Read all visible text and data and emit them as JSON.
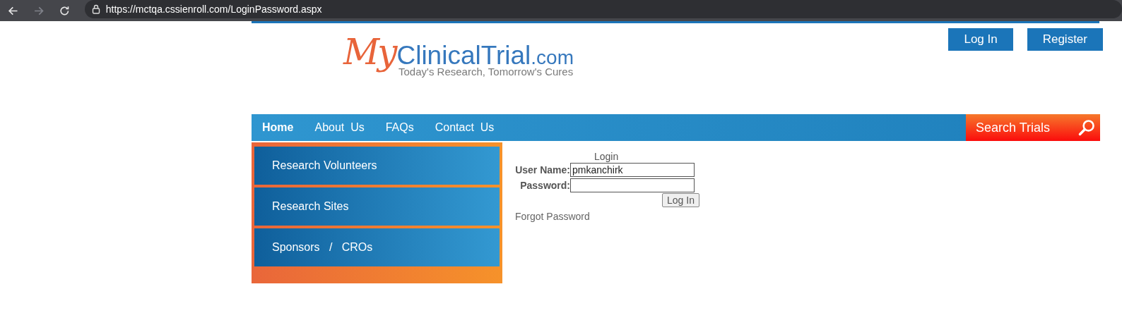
{
  "browser": {
    "url": "https://mctqa.cssienroll.com/LoginPassword.aspx",
    "back_disabled": false,
    "forward_disabled": true
  },
  "logo": {
    "script": "My",
    "name": "ClinicalTrial",
    "domain": ".com",
    "tagline": "Today's Research, Tomorrow's Cures"
  },
  "header_buttons": [
    "Log In",
    "Register"
  ],
  "nav": [
    {
      "label": "Home",
      "selected": true
    },
    {
      "label": "About  Us",
      "selected": false
    },
    {
      "label": "FAQs",
      "selected": false
    },
    {
      "label": "Contact  Us",
      "selected": false
    }
  ],
  "search_button": "Search Trials",
  "sidebar": [
    "Research Volunteers",
    "Research Sites",
    "Sponsors   /   CROs"
  ],
  "login": {
    "title": "Login",
    "username_label": "User Name:",
    "username_value": "pmkanchirk",
    "password_label": "Password:",
    "button": "Log In",
    "forgot_link": "Forgot Password"
  }
}
